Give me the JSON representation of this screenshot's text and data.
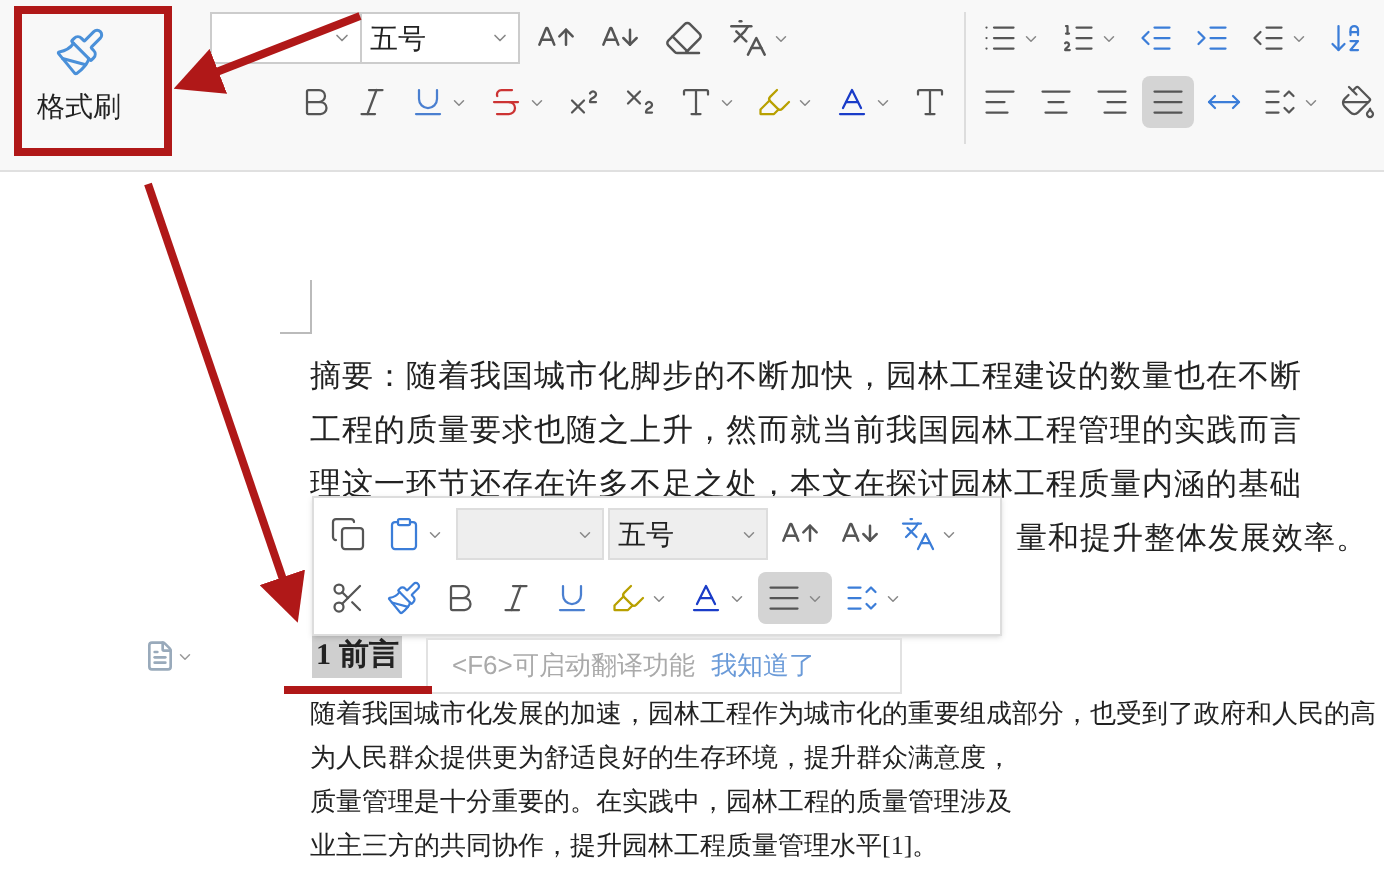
{
  "ribbon": {
    "format_painter": {
      "label": "格式刷"
    },
    "font_size": "五号",
    "alignment": [
      {
        "kind": "left",
        "selected": false
      },
      {
        "kind": "center",
        "selected": false
      },
      {
        "kind": "right",
        "selected": false
      },
      {
        "kind": "justify",
        "selected": true
      },
      {
        "kind": "distributed",
        "selected": false
      }
    ]
  },
  "document": {
    "abstract_lines": [
      "摘要：随着我国城市化脚步的不断加快，园林工程建设的数量也在不断",
      "工程的质量要求也随之上升，然而就当前我国园林工程管理的实践而言",
      "理这一环节还存在许多不足之处，本文在探讨园林工程质量内涵的基础",
      "量和提升整体发展效率。"
    ],
    "heading": {
      "text": "1 前言",
      "selected": true
    },
    "body_lines": [
      "随着我国城市化发展的加速，园林工程作为城市化的重要组成部分，也受到了政府和人民的高",
      "为人民群众提供更为舒适良好的生存环境，提升群众满意度，",
      "质量管理是十分重要的。在实践中，园林工程的质量管理涉及",
      "业主三方的共同协作，提升园林工程质量管理水平[1]。"
    ]
  },
  "mini_toolbar": {
    "font_size": "五号",
    "justify": {
      "selected": true
    }
  },
  "tooltip": {
    "hint": "<F6>可启动翻译功能",
    "action": "我知道了"
  }
}
